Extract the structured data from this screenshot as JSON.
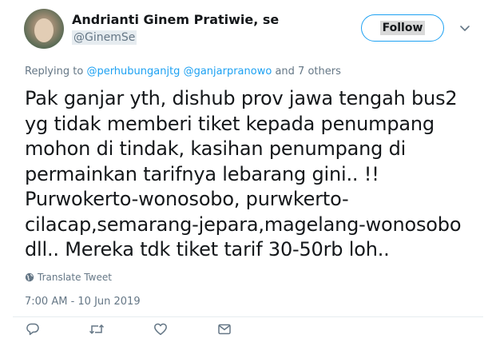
{
  "author": {
    "name": "Andrianti Ginem Pratiwie, se",
    "handle": "@GinemSe"
  },
  "follow_button": {
    "label": "Follow"
  },
  "reply_context": {
    "prefix": "Replying to",
    "mention1": "@perhubunganjtg",
    "mention2": "@ganjarpranowo",
    "suffix": "and 7 others"
  },
  "tweet": {
    "text": "Pak ganjar yth, dishub prov jawa tengah bus2\nyg tidak memberi tiket kepada penumpang\nmohon di tindak, kasihan penumpang di\npermainkan tarifnya lebarang gini.. !!\nPurwokerto-wonosobo, purwkerto-\ncilacap,semarang-jepara,magelang-wonosobo\ndll.. Mereka tdk tiket tarif 30-50rb loh..",
    "translate_label": "Translate Tweet",
    "timestamp": "7:00 AM - 10 Jun 2019"
  },
  "icons": {
    "reply": "reply-icon",
    "retweet": "retweet-icon",
    "like": "heart-icon",
    "dm": "envelope-icon",
    "more": "chevron-down-icon",
    "globe": "globe-icon"
  },
  "colors": {
    "accent": "#1da1f2",
    "muted": "#657786",
    "text": "#14171a"
  }
}
